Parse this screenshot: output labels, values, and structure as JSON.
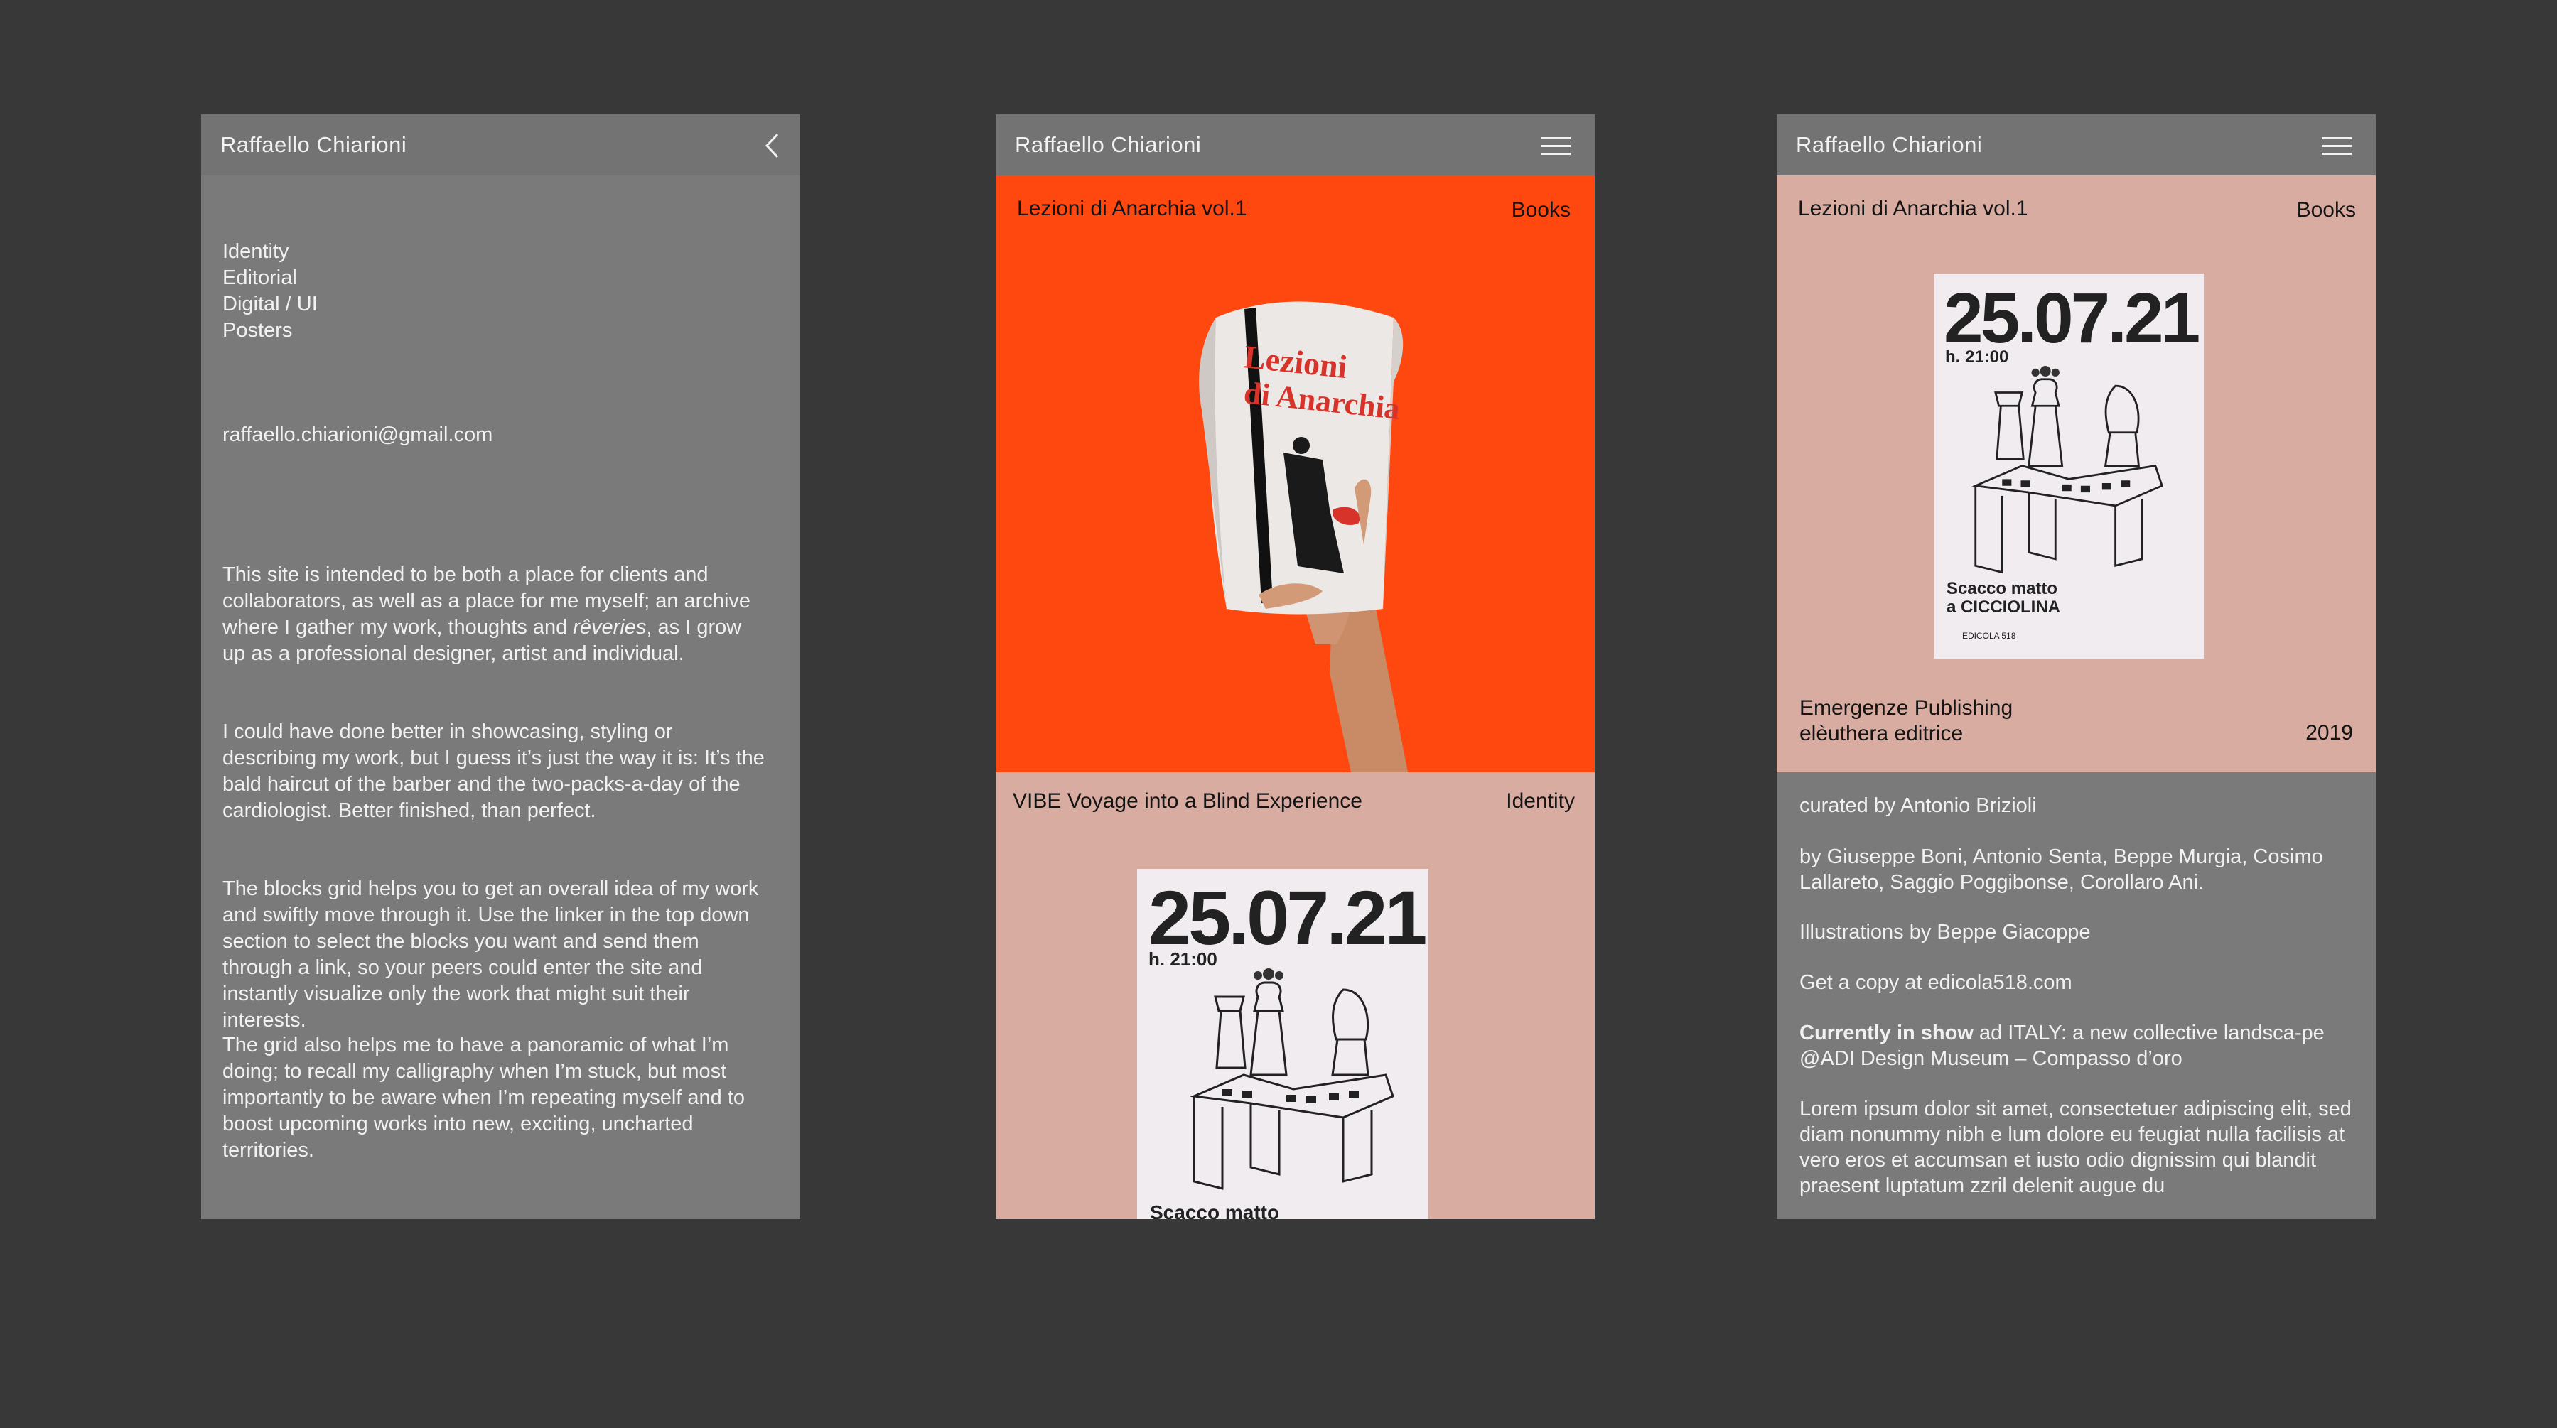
{
  "site_name": "Raffaello Chiarioni",
  "menu": {
    "categories": [
      "Identity",
      "Editorial",
      "Digital / UI",
      "Posters"
    ],
    "email": "raffaello.chiarioni@gmail.com",
    "para1_a": "This site is intended to be both a place for clients and collaborators, as well as a place for me myself; an archive where I gather my work, thoughts and ",
    "para1_em": "rêveries",
    "para1_b": ", as I grow up as a professional designer, artist and individual.",
    "para2": "I could have done better in showcasing, styling or describing my work, but I guess it’s just the way it is: It’s the bald haircut of the barber and the two-packs-a-day of the cardiologist. Better finished, than perfect.",
    "para3": "The blocks grid helps you to get an overall idea of my work and swiftly move through it. Use the linker in the top down section to select the blocks you want and send them through a link, so your peers could enter the site and instantly visualize only the work that might suit their interests.",
    "para4": "The grid also helps me to have a panoramic of what I’m doing; to recall my calligraphy when I’m stuck, but most importantly to be aware when I’m repeating myself and to boost upcoming works into new, exciting, uncharted territories."
  },
  "grid": {
    "block1": {
      "title": "Lezioni di Anarchia vol.1",
      "category": "Books",
      "bg": "#ff4710"
    },
    "block2": {
      "title": "VIBE Voyage into a Blind Experience",
      "category": "Identity",
      "bg": "#d9aca1"
    }
  },
  "detail": {
    "title": "Lezioni di Anarchia vol.1",
    "category": "Books",
    "publisher_1": "Emergenze Publishing",
    "publisher_2": "elèuthera editrice",
    "year": "2019",
    "curated": "curated by Antonio Brizioli",
    "authors": "by Giuseppe Boni, Antonio Senta, Beppe Murgia, Cosimo Lallareto, Saggio Poggibonse, Corollaro Ani.",
    "illustrations": "Illustrations by Beppe Giacoppe",
    "copy": "Get a copy at edicola518.com",
    "show_label": "Currently in show",
    "show_text": " ad ITALY: a new collective landsca-pe @ADI Design Museum – Compasso d’oro",
    "lorem": "Lorem ipsum dolor sit amet, consectetuer adipiscing elit, sed diam nonummy nibh e  lum dolore eu feugiat nulla facilisis at vero eros et accumsan et iusto odio dignissim qui blandit praesent luptatum zzril delenit augue du"
  },
  "poster": {
    "date": "25.07.21",
    "time": "h. 21:00",
    "subtitle_1": "Scacco matto",
    "subtitle_2": "a CICCIOLINA",
    "footer": "EDICOLA 518"
  },
  "book_cover": {
    "line1": "Lezioni",
    "line2": "di Anarchia"
  },
  "icons": {
    "back": "chevron-left-icon",
    "menu": "hamburger-menu-icon"
  }
}
